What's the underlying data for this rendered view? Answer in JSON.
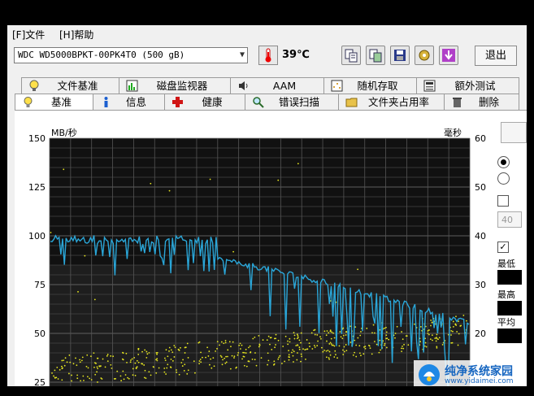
{
  "menu": {
    "file": "[F]文件",
    "help": "[H]帮助"
  },
  "toolbar": {
    "drive": "WDC WD5000BPKT-00PK4T0 (500 gB)",
    "temperature": "39℃",
    "exit": "退出",
    "icons": [
      "copy-text-icon",
      "copy-screen-icon",
      "save-icon",
      "options-icon",
      "download-icon"
    ]
  },
  "tabs_top": [
    {
      "label": "文件基准",
      "icon": "file-benchmark-icon"
    },
    {
      "label": "磁盘监视器",
      "icon": "disk-monitor-icon"
    },
    {
      "label": "AAM",
      "icon": "speaker-icon"
    },
    {
      "label": "随机存取",
      "icon": "random-access-icon"
    },
    {
      "label": "额外测试",
      "icon": "extra-tests-icon"
    }
  ],
  "tabs_bottom": [
    {
      "label": "基准",
      "icon": "bulb-icon"
    },
    {
      "label": "信息",
      "icon": "info-icon"
    },
    {
      "label": "健康",
      "icon": "health-cross-icon"
    },
    {
      "label": "错误扫描",
      "icon": "magnifier-icon"
    },
    {
      "label": "文件夹占用率",
      "icon": "folder-icon"
    },
    {
      "label": "删除",
      "icon": "trash-icon"
    }
  ],
  "chart_data": {
    "type": "line",
    "y_left_label": "MB/秒",
    "y_right_label": "毫秒",
    "y_left_ticks": [
      150,
      125,
      100,
      75,
      50,
      25
    ],
    "y_right_ticks": [
      60,
      50,
      40,
      30,
      20
    ],
    "ylim_left": [
      25,
      150
    ],
    "ylim_right": [
      10,
      60
    ],
    "grid": true,
    "series": [
      {
        "name": "transfer_rate",
        "color": "#2aa6d8",
        "trend_start": 98,
        "trend_end": 55
      },
      {
        "name": "access_time",
        "color": "#e8e820",
        "range": [
          25,
          55
        ]
      }
    ]
  },
  "side": {
    "cut_labels": [
      "最低",
      "最高",
      "平均"
    ],
    "cut_value": "40"
  },
  "watermark": {
    "line1": "纯净系统家园",
    "line2": "www.yidaimei.com"
  }
}
